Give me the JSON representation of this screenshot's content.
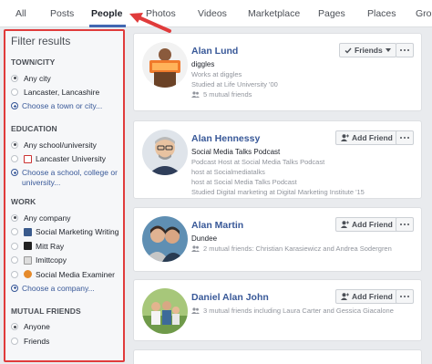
{
  "tabs": [
    {
      "label": "All"
    },
    {
      "label": "Posts"
    },
    {
      "label": "People"
    },
    {
      "label": "Photos"
    },
    {
      "label": "Videos"
    },
    {
      "label": "Marketplace"
    },
    {
      "label": "Pages"
    },
    {
      "label": "Places"
    },
    {
      "label": "Gro"
    }
  ],
  "active_tab": "People",
  "accent_color": "#4267b2",
  "highlight_color": "#e03b3b",
  "sidebar": {
    "title": "Filter results",
    "town": {
      "heading": "TOWN/CITY",
      "options": [
        "Any city",
        "Lancaster, Lancashire"
      ],
      "selected": "Any city",
      "link": "Choose a town or city..."
    },
    "education": {
      "heading": "EDUCATION",
      "options": [
        "Any school/university",
        "Lancaster University"
      ],
      "selected": "Any school/university",
      "link": "Choose a school, college or university..."
    },
    "work": {
      "heading": "WORK",
      "options": [
        "Any company",
        "Social Marketing Writing",
        "Mitt Ray",
        "Imittcopy",
        "Social Media Examiner"
      ],
      "selected": "Any company",
      "link": "Choose a company..."
    },
    "mutual": {
      "heading": "MUTUAL FRIENDS",
      "options": [
        "Anyone",
        "Friends"
      ],
      "selected": "Anyone"
    }
  },
  "results": [
    {
      "name": "Alan Lund",
      "subtitle": "diggles",
      "details": [
        "Works at diggles",
        "Studied at Life University '00"
      ],
      "mutual": "5 mutual friends",
      "action": "Friends",
      "action_icon": "check-icon"
    },
    {
      "name": "Alan Hennessy",
      "subtitle": "Social Media Talks Podcast",
      "details": [
        "Podcast Host at Social Media Talks Podcast",
        "host at Socialmediatalks",
        "host at Social Media Talks Podcast",
        "Studied Digital marketing at Digital Marketing Institute '15"
      ],
      "mutual": "",
      "action": "Add Friend",
      "action_icon": "add-friend-icon"
    },
    {
      "name": "Alan Martin",
      "subtitle": "Dundee",
      "details": [],
      "mutual": "2 mutual friends: Christian Karasiewicz and Andrea Sodergren",
      "action": "Add Friend",
      "action_icon": "add-friend-icon"
    },
    {
      "name": "Daniel Alan John",
      "subtitle": "",
      "details": [],
      "mutual": "3 mutual friends including Laura Carter and Gessica Giacalone",
      "action": "Add Friend",
      "action_icon": "add-friend-icon"
    }
  ]
}
